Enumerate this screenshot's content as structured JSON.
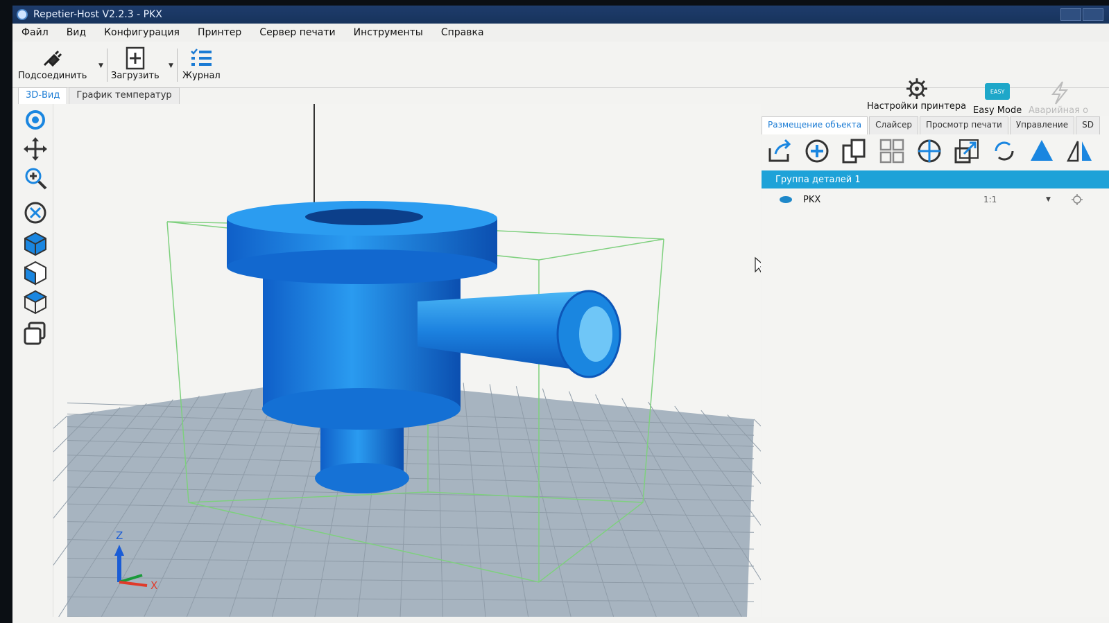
{
  "window": {
    "title": "Repetier-Host V2.2.3 - PKX"
  },
  "menu": [
    "Файл",
    "Вид",
    "Конфигурация",
    "Принтер",
    "Сервер печати",
    "Инструменты",
    "Справка"
  ],
  "toolbar": {
    "connect_label": "Подсоединить",
    "load_label": "Загрузить",
    "log_label": "Журнал",
    "printer_settings_label": "Настройки принтера",
    "easy_mode_label": "Easy Mode",
    "easy_badge": "EASY",
    "emergency_label": "Аварийная о"
  },
  "view_tabs": [
    "3D-Вид",
    "График температур"
  ],
  "right_tabs": [
    "Размещение объекта",
    "Слайсер",
    "Просмотр печати",
    "Управление",
    "SD"
  ],
  "object_group": {
    "label": "Группа деталей 1"
  },
  "objects": [
    {
      "name": "PKX",
      "scale": "1:1"
    }
  ],
  "axes": {
    "z": "Z",
    "x": "X"
  },
  "colors": {
    "accent": "#1ea2d8",
    "model": "#1a86e0",
    "bed": "#a7b4c0"
  }
}
